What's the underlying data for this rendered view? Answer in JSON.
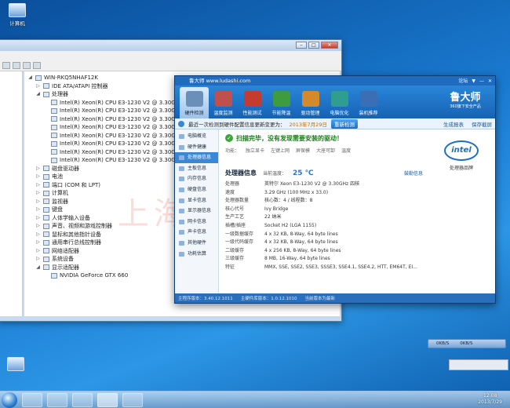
{
  "desktop": {
    "icons": [
      {
        "label": "计算机"
      }
    ],
    "watermark": "上海名品信息"
  },
  "device_manager": {
    "tree": [
      {
        "label": "WIN-RKQ5NHAF12K",
        "level": 0,
        "exp": "◢"
      },
      {
        "label": "IDE ATA/ATAPI 控制器",
        "level": 1,
        "exp": "▷"
      },
      {
        "label": "处理器",
        "level": 1,
        "exp": "◢"
      },
      {
        "label": "Intel(R) Xeon(R) CPU E3-1230 V2 @ 3.30GHz",
        "level": 2,
        "exp": ""
      },
      {
        "label": "Intel(R) Xeon(R) CPU E3-1230 V2 @ 3.30GHz",
        "level": 2,
        "exp": ""
      },
      {
        "label": "Intel(R) Xeon(R) CPU E3-1230 V2 @ 3.30GHz",
        "level": 2,
        "exp": ""
      },
      {
        "label": "Intel(R) Xeon(R) CPU E3-1230 V2 @ 3.30GHz",
        "level": 2,
        "exp": ""
      },
      {
        "label": "Intel(R) Xeon(R) CPU E3-1230 V2 @ 3.30GHz",
        "level": 2,
        "exp": ""
      },
      {
        "label": "Intel(R) Xeon(R) CPU E3-1230 V2 @ 3.30GHz",
        "level": 2,
        "exp": ""
      },
      {
        "label": "Intel(R) Xeon(R) CPU E3-1230 V2 @ 3.30GHz",
        "level": 2,
        "exp": ""
      },
      {
        "label": "Intel(R) Xeon(R) CPU E3-1230 V2 @ 3.30GHz",
        "level": 2,
        "exp": ""
      },
      {
        "label": "磁盘驱动器",
        "level": 1,
        "exp": "▷"
      },
      {
        "label": "电池",
        "level": 1,
        "exp": "▷"
      },
      {
        "label": "端口 (COM 和 LPT)",
        "level": 1,
        "exp": "▷"
      },
      {
        "label": "计算机",
        "level": 1,
        "exp": "▷"
      },
      {
        "label": "监视器",
        "level": 1,
        "exp": "▷"
      },
      {
        "label": "键盘",
        "level": 1,
        "exp": "▷"
      },
      {
        "label": "人体学输入设备",
        "level": 1,
        "exp": "▷"
      },
      {
        "label": "声音、视频和游戏控制器",
        "level": 1,
        "exp": "▷"
      },
      {
        "label": "鼠标和其他指针设备",
        "level": 1,
        "exp": "▷"
      },
      {
        "label": "通用串行总线控制器",
        "level": 1,
        "exp": "▷"
      },
      {
        "label": "网络适配器",
        "level": 1,
        "exp": "▷"
      },
      {
        "label": "系统设备",
        "level": 1,
        "exp": "▷"
      },
      {
        "label": "显示适配器",
        "level": 1,
        "exp": "◢"
      },
      {
        "label": "NVIDIA GeForce GTX 660",
        "level": 2,
        "exp": ""
      }
    ]
  },
  "ludashi": {
    "title": "鲁大师 www.ludashi.com",
    "title_ctrls": [
      "论坛",
      "▼",
      "—",
      "✕"
    ],
    "tabs": [
      {
        "label": "硬件检测",
        "color": "#6a8fb8"
      },
      {
        "label": "温度监测",
        "color": "#c0504d"
      },
      {
        "label": "性能测试",
        "color": "#c63b2f"
      },
      {
        "label": "节能降温",
        "color": "#3e9b3e"
      },
      {
        "label": "驱动管理",
        "color": "#d48a2a"
      },
      {
        "label": "电脑优化",
        "color": "#2f9d8f"
      },
      {
        "label": "装机推荐",
        "color": "#3a6fb5"
      }
    ],
    "logo_big": "鲁大师",
    "logo_small": "360旗下安全产品",
    "info_bar": {
      "text": "最近一次检测到硬件配置信息更新变更为：",
      "date": "2013年7月29日",
      "button": "重新检测",
      "right": [
        "生成报表",
        "保存截屏"
      ]
    },
    "sidebar": [
      "电脑概览",
      "硬件健康",
      "处理器信息",
      "主板信息",
      "内存信息",
      "硬盘信息",
      "显卡信息",
      "显示器信息",
      "网卡信息",
      "声卡信息",
      "其他硬件",
      "功耗估算"
    ],
    "sidebar_active": 2,
    "status": "扫描完毕，没有发现需要安装的驱动！",
    "func_label": "功能：",
    "func_items": [
      "独立显卡",
      "左键上网",
      "屏保模",
      "大座可卸",
      "温度"
    ],
    "section": {
      "title": "处理器信息",
      "temp_label": "当前温度：",
      "temp": "25 ℃",
      "link": "鼓勒信息"
    },
    "cpu_rows": [
      {
        "k": "处理器",
        "v": "英特尔 Xeon E3-1230 V2 @ 3.30GHz 四核"
      },
      {
        "k": "速度",
        "v": "3.29 GHz (100 MHz x 33.0)"
      },
      {
        "k": "处理器数量",
        "v": "核心数：4 / 线程数：8"
      },
      {
        "k": "核心代号",
        "v": "Ivy Bridge"
      },
      {
        "k": "生产工艺",
        "v": "22 纳米"
      },
      {
        "k": "插槽/插座",
        "v": "Socket H2 (LGA 1155)"
      },
      {
        "k": "一级数据缓存",
        "v": "4 x 32 KB, 8-Way, 64 byte lines"
      },
      {
        "k": "一级代码缓存",
        "v": "4 x 32 KB, 8-Way, 64 byte lines"
      },
      {
        "k": "二级缓存",
        "v": "4 x 256 KB, 8-Way, 64 byte lines"
      },
      {
        "k": "三级缓存",
        "v": "8 MB, 16-Way, 64 byte lines"
      },
      {
        "k": "特征",
        "v": "MMX, SSE, SSE2, SSE3, SSSE3, SSE4.1, SSE4.2, HTT, EM64T, EI..."
      }
    ],
    "intel_logo": "intel",
    "intel_caption": "处理器品牌",
    "footer": [
      "主程序版本：3.40.12.1011",
      "主硬件库版本：1.0.12.1010",
      "当前版本为最新"
    ]
  },
  "netwidget": [
    "0KB/S",
    "0KB/S"
  ],
  "taskbar": {
    "clock_time": "12:08",
    "clock_date": "2013/7/29"
  }
}
